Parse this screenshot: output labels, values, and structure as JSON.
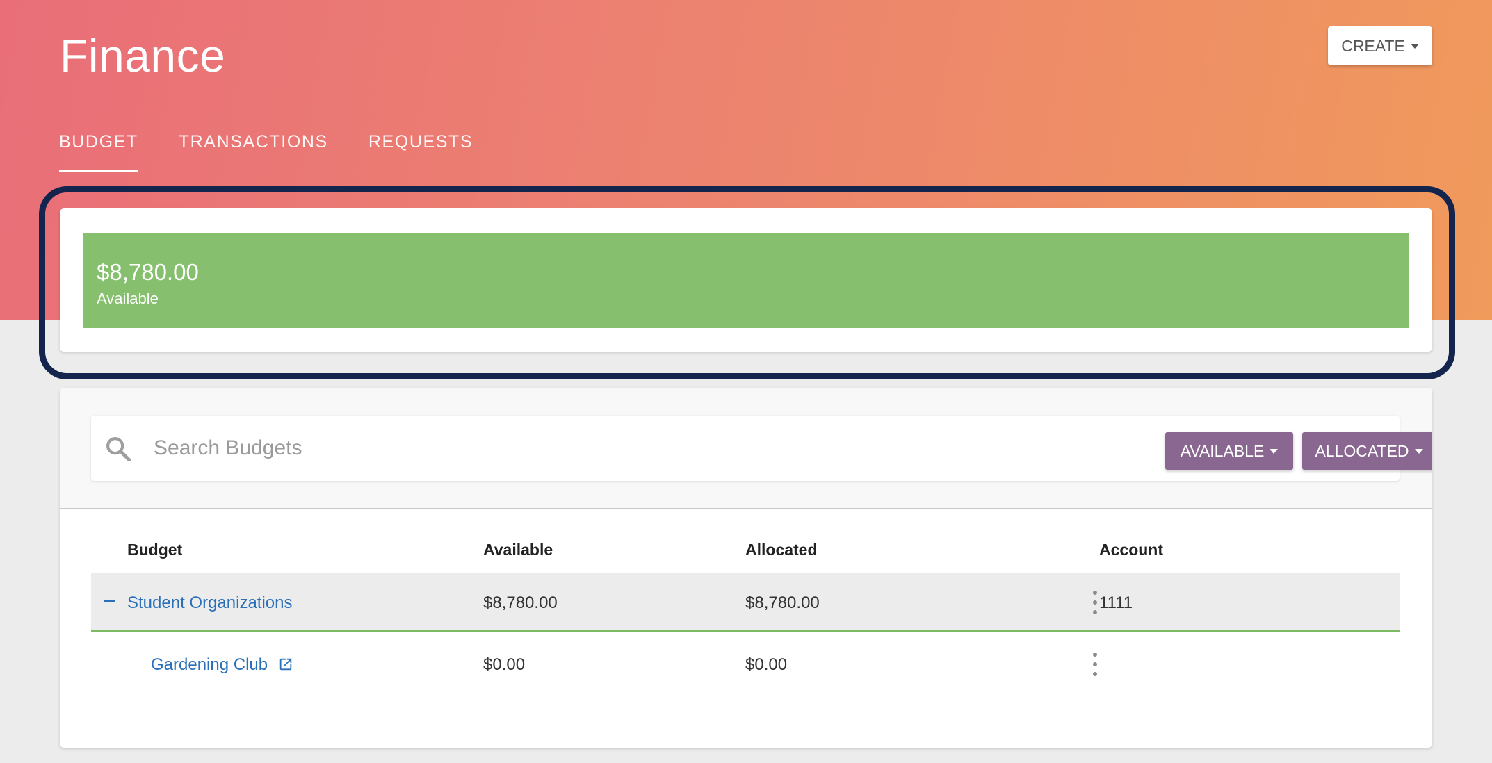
{
  "header": {
    "title": "Finance",
    "create_label": "CREATE"
  },
  "tabs": [
    {
      "label": "BUDGET",
      "active": true
    },
    {
      "label": "TRANSACTIONS",
      "active": false
    },
    {
      "label": "REQUESTS",
      "active": false
    }
  ],
  "summary": {
    "amount": "$8,780.00",
    "label": "Available",
    "bar_color": "#86bf6e"
  },
  "search": {
    "placeholder": "Search Budgets",
    "value": ""
  },
  "filters": {
    "available_label": "AVAILABLE",
    "allocated_label": "ALLOCATED",
    "button_color": "#8a6790"
  },
  "table": {
    "columns": [
      "Budget",
      "Available",
      "Allocated",
      "Account"
    ],
    "rows": [
      {
        "budget": "Student Organizations",
        "available": "$8,780.00",
        "allocated": "$8,780.00",
        "account": "1111",
        "expanded": true
      },
      {
        "budget": "Gardening Club",
        "available": "$0.00",
        "allocated": "$0.00",
        "account": "",
        "external_link_icon": "open-in-new-icon"
      }
    ]
  },
  "colors": {
    "gradient_start": "#e96e78",
    "gradient_end": "#f09a5c",
    "link": "#2a6fb8",
    "highlight_ring": "#13244d"
  }
}
